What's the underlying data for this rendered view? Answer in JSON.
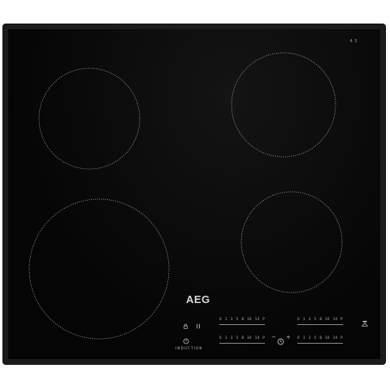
{
  "appliance": {
    "brand": "AEG",
    "type_label": "INDUCTION",
    "model_mark": "4.5"
  },
  "cooking_zones": [
    {
      "name": "rear-left"
    },
    {
      "name": "rear-right"
    },
    {
      "name": "front-left"
    },
    {
      "name": "front-right"
    }
  ],
  "power_sliders": [
    {
      "zone": "rear-left",
      "ticks": [
        "0",
        "1",
        "3",
        "5",
        "8",
        "10",
        "14",
        "P"
      ]
    },
    {
      "zone": "front-left",
      "ticks": [
        "0",
        "1",
        "3",
        "5",
        "8",
        "10",
        "14",
        "P"
      ]
    },
    {
      "zone": "rear-right",
      "ticks": [
        "0",
        "1",
        "3",
        "5",
        "8",
        "10",
        "14",
        "P"
      ]
    },
    {
      "zone": "front-right",
      "ticks": [
        "0",
        "1",
        "3",
        "5",
        "8",
        "10",
        "14",
        "P"
      ]
    }
  ],
  "controls": {
    "lock_icon": "lock-icon",
    "pause_icon": "pause-icon",
    "power_icon": "power-icon",
    "timer_icon": "timer-icon",
    "hob2hood_icon": "hob2hood-icon",
    "timer_minus": "−",
    "timer_plus": "+"
  },
  "colors": {
    "glass": "#0b0b0b",
    "frame": "#1c1c1c",
    "print": "#c9c9c9"
  }
}
